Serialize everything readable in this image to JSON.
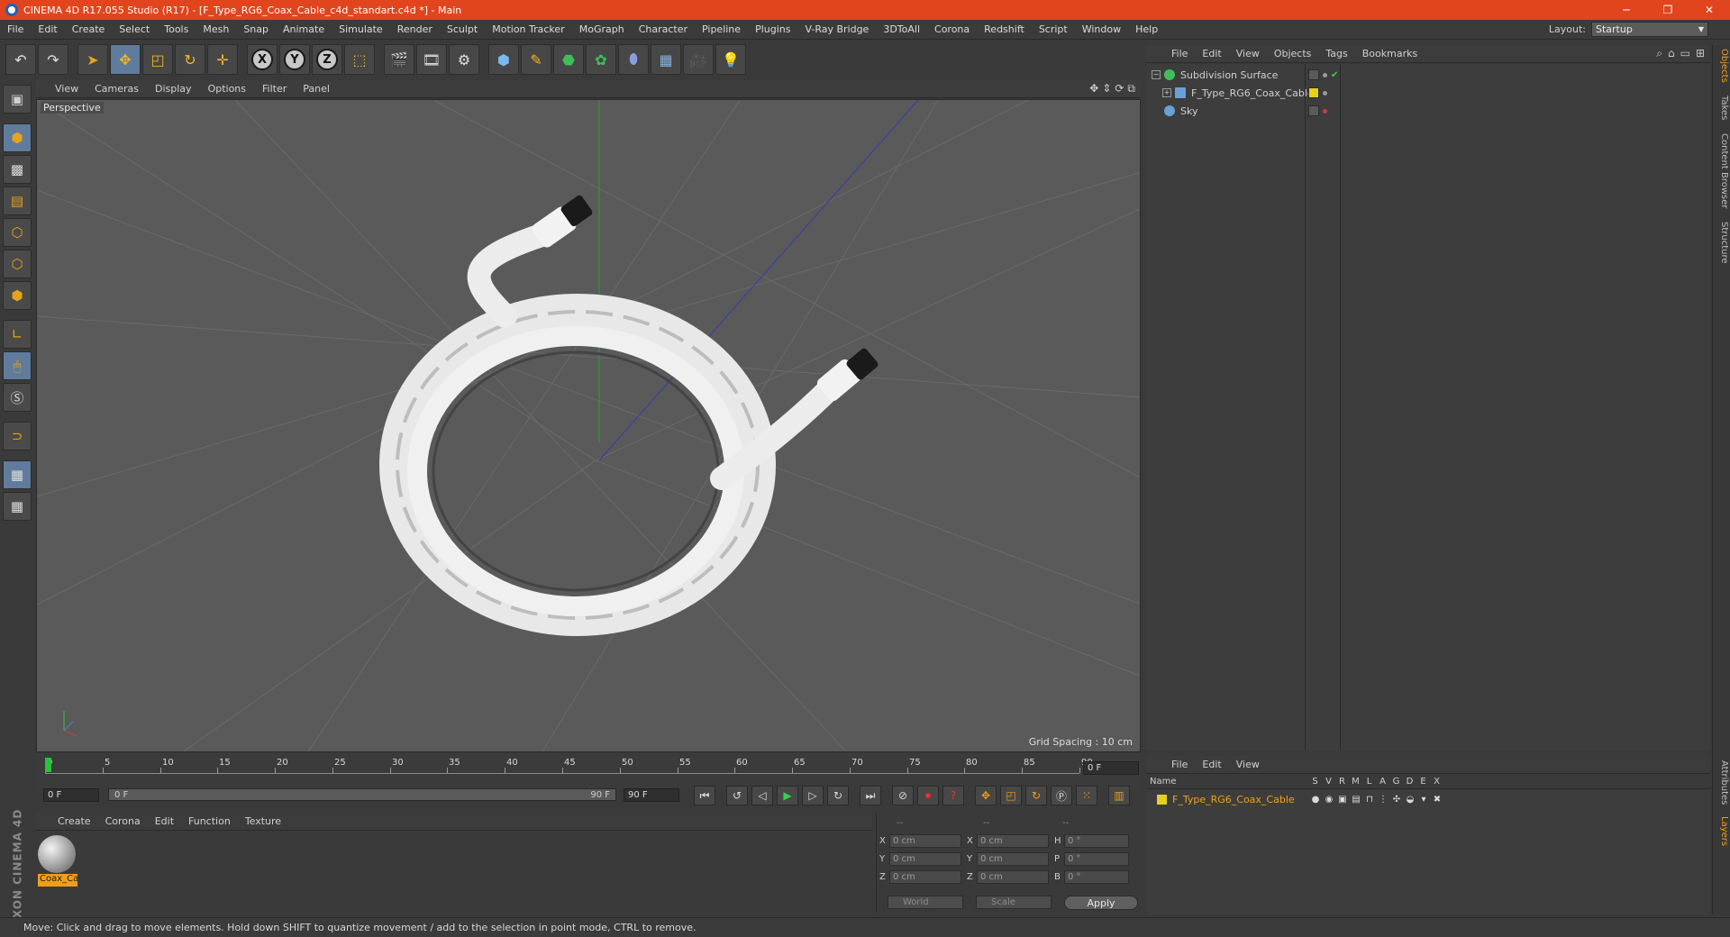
{
  "titlebar": {
    "title": "CINEMA 4D R17.055 Studio (R17) - [F_Type_RG6_Coax_Cable_c4d_standart.c4d *] - Main",
    "minimize": "─",
    "maximize": "❐",
    "close": "✕"
  },
  "menu": {
    "items": [
      "File",
      "Edit",
      "Create",
      "Select",
      "Tools",
      "Mesh",
      "Snap",
      "Animate",
      "Simulate",
      "Render",
      "Sculpt",
      "Motion Tracker",
      "MoGraph",
      "Character",
      "Pipeline",
      "Plugins",
      "V-Ray Bridge",
      "3DToAll",
      "Corona",
      "Redshift",
      "Script",
      "Window",
      "Help"
    ],
    "layout_label": "Layout:",
    "layout_value": "Startup"
  },
  "viewport": {
    "menu": [
      "View",
      "Cameras",
      "Display",
      "Options",
      "Filter",
      "Panel"
    ],
    "label": "Perspective",
    "grid_spacing": "Grid Spacing : 10 cm"
  },
  "timeline": {
    "ticks": [
      "0",
      "5",
      "10",
      "15",
      "20",
      "25",
      "30",
      "35",
      "40",
      "45",
      "50",
      "55",
      "60",
      "65",
      "70",
      "75",
      "80",
      "85",
      "90"
    ],
    "current_frame": "0 F",
    "start_frame": "0 F",
    "range_start": "0 F",
    "range_end": "90 F",
    "end_frame": "90 F"
  },
  "material_manager": {
    "menu": [
      "Create",
      "Corona",
      "Edit",
      "Function",
      "Texture"
    ],
    "material_name": "Coax_Ca"
  },
  "coordinates": {
    "dashes": [
      "--",
      "--",
      "--"
    ],
    "rows": [
      {
        "a1": "X",
        "v1": "0 cm",
        "a2": "X",
        "v2": "0 cm",
        "a3": "H",
        "v3": "0 °"
      },
      {
        "a1": "Y",
        "v1": "0 cm",
        "a2": "Y",
        "v2": "0 cm",
        "a3": "P",
        "v3": "0 °"
      },
      {
        "a1": "Z",
        "v1": "0 cm",
        "a2": "Z",
        "v2": "0 cm",
        "a3": "B",
        "v3": "0 °"
      }
    ],
    "space_mode": "World",
    "size_mode": "Scale",
    "apply_label": "Apply"
  },
  "object_manager": {
    "menu": [
      "File",
      "Edit",
      "View",
      "Objects",
      "Tags",
      "Bookmarks"
    ],
    "objects": [
      {
        "name": "Subdivision Surface",
        "icon_color": "#3fbf5a"
      },
      {
        "name": "F_Type_RG6_Coax_Cable",
        "icon_color": "#6aa0d8"
      },
      {
        "name": "Sky",
        "icon_color": "#6aa0d8"
      }
    ]
  },
  "layers_manager": {
    "menu": [
      "File",
      "Edit",
      "View"
    ],
    "col_name": "Name",
    "col_letters": [
      "S",
      "V",
      "R",
      "M",
      "L",
      "A",
      "G",
      "D",
      "E",
      "X"
    ],
    "layer_name": "F_Type_RG6_Coax_Cable"
  },
  "right_tabs": [
    "Objects",
    "Takes",
    "Content Browser",
    "Structure",
    "Attributes",
    "Layers"
  ],
  "status": {
    "text": "Move: Click and drag to move elements. Hold down SHIFT to quantize movement / add to the selection in point mode, CTRL to remove."
  },
  "logo": "MAXON CINEMA 4D"
}
